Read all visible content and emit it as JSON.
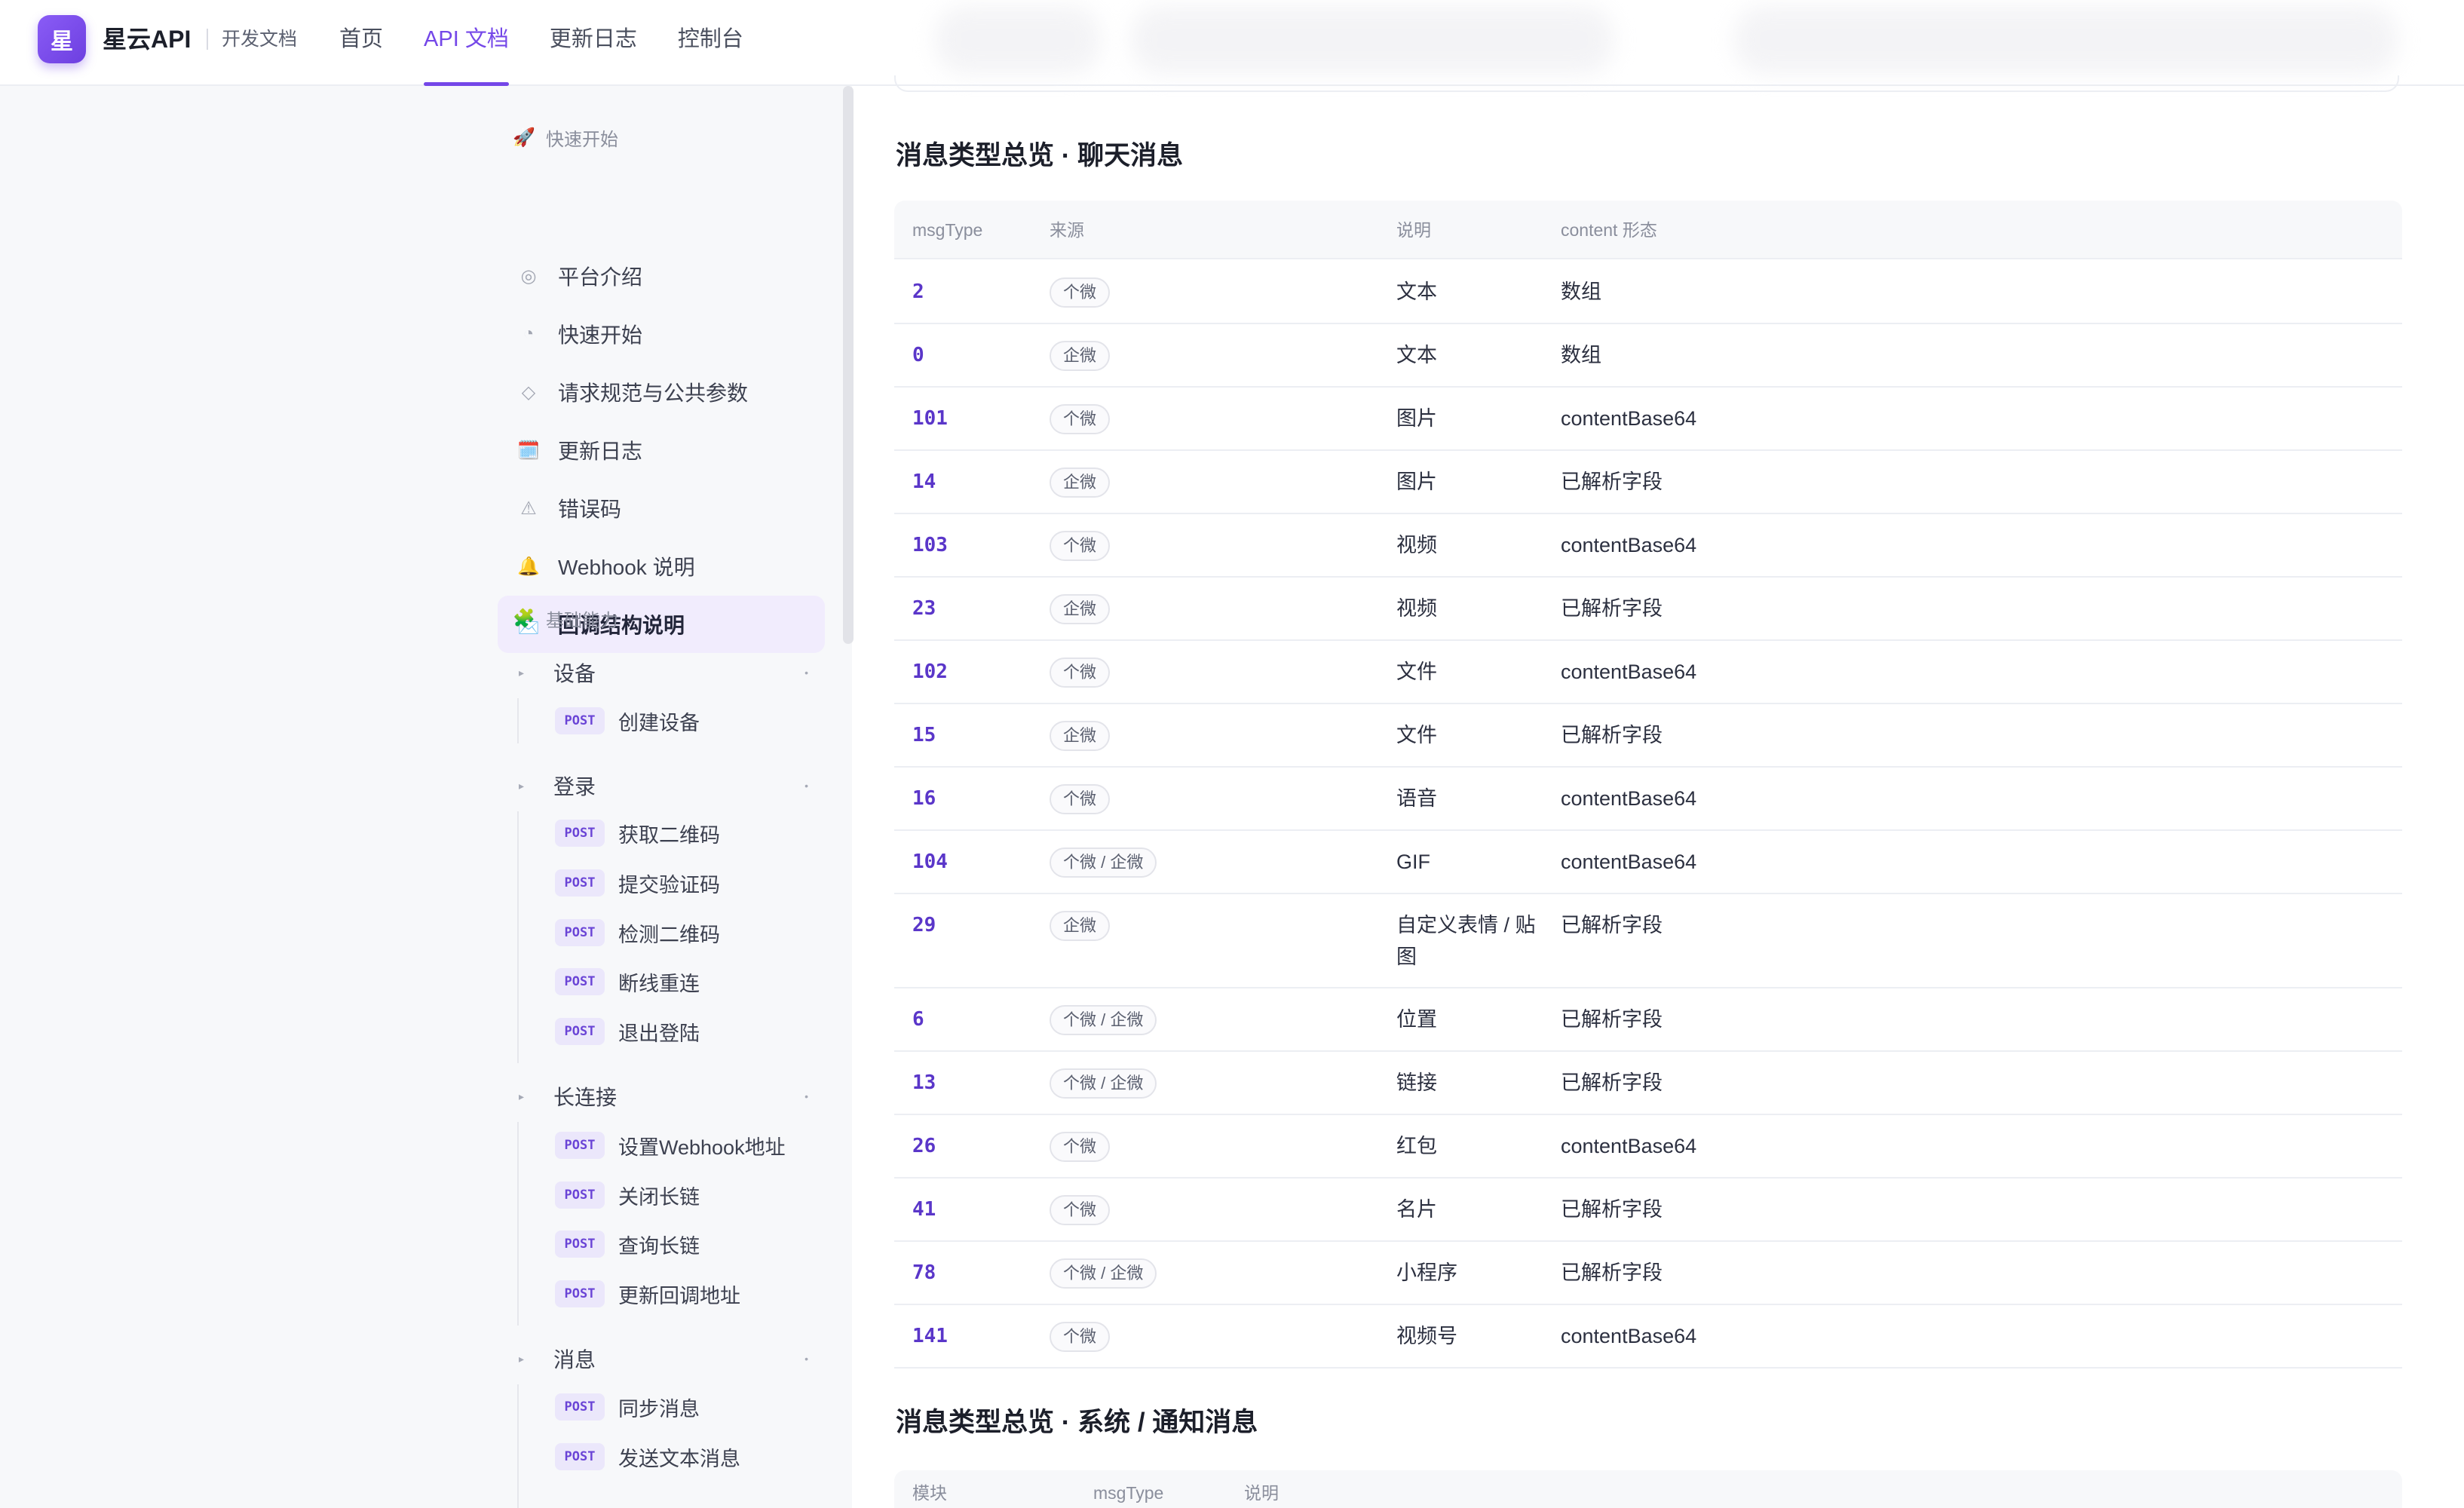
{
  "header": {
    "logo_char": "星",
    "brand": "星云API",
    "subtitle": "开发文档",
    "nav": [
      "首页",
      "API 文档",
      "更新日志",
      "控制台"
    ]
  },
  "sidebar": {
    "quickstart": {
      "title": "快速开始",
      "items": [
        {
          "icon": "◎",
          "label": "平台介绍"
        },
        {
          "icon": "◔",
          "label": "快速开始"
        },
        {
          "icon": "◇",
          "label": "请求规范与公共参数"
        },
        {
          "icon": "🗓️",
          "label": "更新日志"
        },
        {
          "icon": "⚠",
          "label": "错误码"
        },
        {
          "icon": "🔔",
          "label": "Webhook 说明"
        },
        {
          "icon": "📩",
          "label": "回调结构说明"
        }
      ]
    },
    "basic": {
      "title": "基础能力",
      "groups": [
        {
          "label": "设备",
          "endpoints": [
            "创建设备"
          ]
        },
        {
          "label": "登录",
          "endpoints": [
            "获取二维码",
            "提交验证码",
            "检测二维码",
            "断线重连",
            "退出登陆"
          ]
        },
        {
          "label": "长连接",
          "endpoints": [
            "设置Webhook地址",
            "关闭长链",
            "查询长链",
            "更新回调地址"
          ]
        },
        {
          "label": "消息",
          "endpoints": [
            "同步消息",
            "发送文本消息"
          ]
        }
      ],
      "method": "POST"
    }
  },
  "main": {
    "chat_section": {
      "title": "消息类型总览 · 聊天消息",
      "headers": [
        "msgType",
        "来源",
        "说明",
        "content 形态"
      ],
      "rows": [
        {
          "code": "2",
          "source": "个微",
          "desc": "文本",
          "content": "数组"
        },
        {
          "code": "0",
          "source": "企微",
          "desc": "文本",
          "content": "数组"
        },
        {
          "code": "101",
          "source": "个微",
          "desc": "图片",
          "content": "contentBase64"
        },
        {
          "code": "14",
          "source": "企微",
          "desc": "图片",
          "content": "已解析字段"
        },
        {
          "code": "103",
          "source": "个微",
          "desc": "视频",
          "content": "contentBase64"
        },
        {
          "code": "23",
          "source": "企微",
          "desc": "视频",
          "content": "已解析字段"
        },
        {
          "code": "102",
          "source": "个微",
          "desc": "文件",
          "content": "contentBase64"
        },
        {
          "code": "15",
          "source": "企微",
          "desc": "文件",
          "content": "已解析字段"
        },
        {
          "code": "16",
          "source": "个微",
          "desc": "语音",
          "content": "contentBase64"
        },
        {
          "code": "104",
          "source": "个微 / 企微",
          "desc": "GIF",
          "content": "contentBase64"
        },
        {
          "code": "29",
          "source": "企微",
          "desc": "自定义表情 / 贴图",
          "content": "已解析字段"
        },
        {
          "code": "6",
          "source": "个微 / 企微",
          "desc": "位置",
          "content": "已解析字段"
        },
        {
          "code": "13",
          "source": "个微 / 企微",
          "desc": "链接",
          "content": "已解析字段"
        },
        {
          "code": "26",
          "source": "个微",
          "desc": "红包",
          "content": "contentBase64"
        },
        {
          "code": "41",
          "source": "个微",
          "desc": "名片",
          "content": "已解析字段"
        },
        {
          "code": "78",
          "source": "个微 / 企微",
          "desc": "小程序",
          "content": "已解析字段"
        },
        {
          "code": "141",
          "source": "个微",
          "desc": "视频号",
          "content": "contentBase64"
        }
      ]
    },
    "system_section": {
      "title": "消息类型总览 · 系统 / 通知消息",
      "headers": [
        "模块",
        "msgType",
        "说明"
      ]
    }
  }
}
